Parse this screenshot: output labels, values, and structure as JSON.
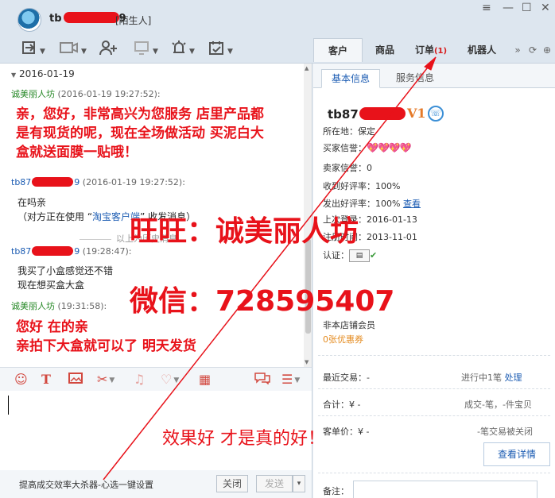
{
  "title_bar": {
    "username_prefix": "tb",
    "username_suffix": "9",
    "relation": "[陌生人]",
    "controls": [
      "≡",
      "—",
      "☐",
      "✕"
    ]
  },
  "toolbar": {
    "tabs": [
      {
        "label": "客户",
        "badge": ""
      },
      {
        "label": "商品",
        "badge": ""
      },
      {
        "label": "订单",
        "badge": "(1)"
      },
      {
        "label": "机器人",
        "badge": ""
      }
    ],
    "more": "»",
    "refresh": "⟳",
    "add": "⊕"
  },
  "chat": {
    "date": "2016-01-19",
    "messages": [
      {
        "sender": "诚美丽人坊",
        "time": "(2016-01-19 19:27:52):",
        "lines": [
          "亲，您好，非常高兴为您服务 店里产品都",
          "是有现货的呢，现在全场做活动 买泥白大",
          "盒就送面膜一贴哦！"
        ]
      },
      {
        "sender_prefix": "tb87",
        "sender_suffix": "9",
        "time": "(2016-01-19 19:27:52):",
        "line1": "在吗亲",
        "line2_prefix": "（对方正在使用 “",
        "line2_link": "淘宝客户端",
        "line2_suffix": "” 收发消息）"
      },
      {
        "history": "以上为历史消息"
      },
      {
        "sender_prefix": "tb87",
        "sender_suffix": "9",
        "time": "(19:28:47):",
        "lines": [
          "我买了小盒感觉还不错",
          "现在想买盒大盒"
        ]
      },
      {
        "sender": "诚美丽人坊",
        "time": "(19:31:58):",
        "lines": [
          "您好 在的亲",
          "亲拍下大盒就可以了 明天发货"
        ]
      }
    ]
  },
  "input": {
    "tip": "提高成交效率大杀器-心选一键设置",
    "close": "关闭",
    "send": "发送",
    "send_arrow": "▾"
  },
  "right_panel": {
    "tabs": [
      "基本信息",
      "服务信息"
    ],
    "name_prefix": "tb87",
    "vip": "V1",
    "location_label": "所在地：",
    "location_value": "保定",
    "buyer_credit_label": "买家信誉：",
    "buyer_credit_hearts": "💖💖💖💖",
    "seller_credit_label": "卖家信誉：",
    "seller_credit_value": "0",
    "received_rate_label": "收到好评率：",
    "received_rate_value": "100%",
    "given_rate_label": "发出好评率：",
    "given_rate_value": "100%",
    "given_rate_link": "查看",
    "last_login_label": "上次登录：",
    "last_login_value": "2016-01-13",
    "register_label": "注册时间：",
    "register_value": "2013-11-01",
    "cert_label": "认证：",
    "member_label": "非本店铺会员",
    "coupon": "0张优惠券",
    "recent_trade_label": "最近交易：",
    "recent_trade_value": "-",
    "in_progress": "进行中1笔",
    "handle": "处理",
    "total_label": "合计：",
    "total_value": "¥ -",
    "total_right": "成交-笔，-件宝贝",
    "unit_price_label": "客单价：",
    "unit_price_value": "¥ -",
    "unit_price_right": "-笔交易被关闭",
    "detail_button": "查看详情",
    "note_label": "备注："
  },
  "watermark": {
    "line1": "旺旺：诚美丽人坊",
    "line2": "微信：728595407",
    "line3": "效果好 才是真的好！"
  },
  "colors": {
    "accent_red": "#e8121a",
    "link_blue": "#1d5db3",
    "seller_green": "#2a8a2a",
    "panel_bg": "#dde6ef"
  }
}
